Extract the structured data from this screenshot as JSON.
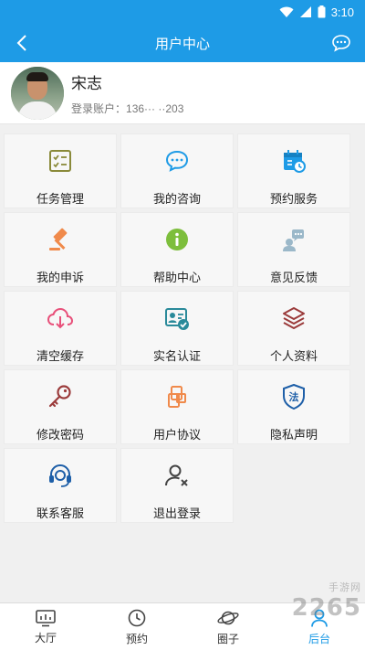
{
  "status_bar": {
    "time": "3:10"
  },
  "header": {
    "title": "用户中心"
  },
  "profile": {
    "name": "宋志",
    "account_label": "登录账户：",
    "account_value": "136··· ··203"
  },
  "menu": [
    {
      "label": "任务管理",
      "icon": "task-list-icon"
    },
    {
      "label": "我的咨询",
      "icon": "consult-chat-icon"
    },
    {
      "label": "预约服务",
      "icon": "calendar-clock-icon"
    },
    {
      "label": "我的申诉",
      "icon": "gavel-icon"
    },
    {
      "label": "帮助中心",
      "icon": "info-circle-icon"
    },
    {
      "label": "意见反馈",
      "icon": "feedback-icon"
    },
    {
      "label": "清空缓存",
      "icon": "cloud-download-icon"
    },
    {
      "label": "实名认证",
      "icon": "id-card-verified-icon"
    },
    {
      "label": "个人资料",
      "icon": "layers-icon"
    },
    {
      "label": "修改密码",
      "icon": "key-icon"
    },
    {
      "label": "用户协议",
      "icon": "agreement-icon"
    },
    {
      "label": "隐私声明",
      "icon": "law-shield-icon"
    },
    {
      "label": "联系客服",
      "icon": "headset-icon"
    },
    {
      "label": "退出登录",
      "icon": "user-remove-icon"
    }
  ],
  "tabs": [
    {
      "label": "大厅",
      "icon": "hall-icon"
    },
    {
      "label": "预约",
      "icon": "clock-icon"
    },
    {
      "label": "圈子",
      "icon": "planet-icon"
    },
    {
      "label": "后台",
      "icon": "user-icon"
    }
  ],
  "watermark": {
    "text": "2265",
    "sub": "手游网"
  },
  "colors": {
    "primary": "#1e9be6",
    "orange": "#f08a4b",
    "green": "#7dbe3c",
    "pink": "#e8507a",
    "dark_red": "#9b3b3b",
    "olive": "#8a8a3a"
  }
}
